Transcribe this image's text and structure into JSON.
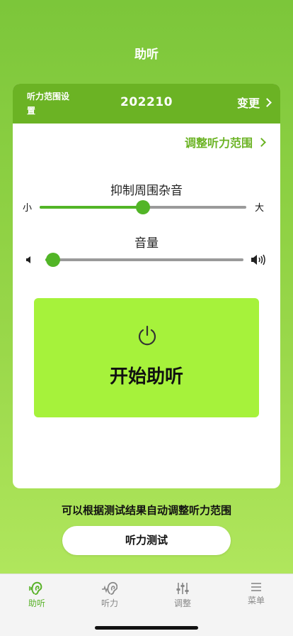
{
  "header": {
    "title": "助听"
  },
  "range": {
    "label": "听力范围设置",
    "value": "202210",
    "change_label": "变更"
  },
  "adjust_link": "调整听力范围",
  "noise": {
    "title": "抑制周围杂音",
    "min_label": "小",
    "max_label": "大",
    "level": 0.5
  },
  "volume": {
    "title": "音量",
    "level": 0.04
  },
  "power": {
    "label": "开始助听"
  },
  "hint": "可以根据测试结果自动调整听力范围",
  "test_button": "听力测试",
  "tabs": [
    {
      "label": "助听",
      "icon": "ear-icon",
      "active": true
    },
    {
      "label": "听力",
      "icon": "hearing-wave-icon",
      "active": false
    },
    {
      "label": "调整",
      "icon": "sliders-icon",
      "active": false
    },
    {
      "label": "菜单",
      "icon": "menu-icon",
      "active": false
    }
  ],
  "colors": {
    "accent": "#6bb324",
    "button": "#a6f23b",
    "slider": "#52b527"
  }
}
